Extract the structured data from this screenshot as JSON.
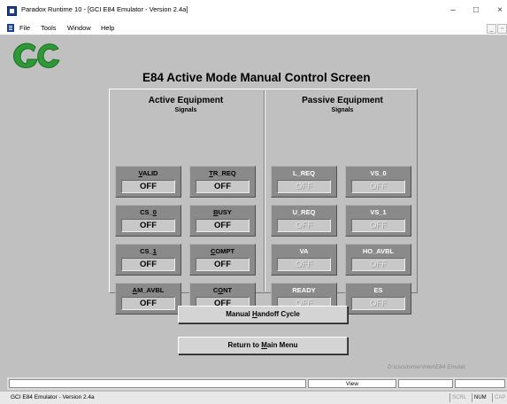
{
  "window": {
    "title": "Paradox Runtime 10 - [GCI E84 Emulator - Version 2.4a]",
    "minimize": "–",
    "maximize": "□",
    "close": "×"
  },
  "menu": {
    "items": [
      "File",
      "Tools",
      "Window",
      "Help"
    ],
    "mdi_minimize": "_",
    "mdi_restore": "▫"
  },
  "logo": {
    "text": "GC",
    "colors": [
      "#2e9a37",
      "#1b6e24"
    ]
  },
  "screen_title": "E84 Active Mode Manual Control Screen",
  "active": {
    "title": "Active Equipment",
    "subtitle": "Signals",
    "signals": [
      {
        "name": "VALID",
        "value": "OFF"
      },
      {
        "name": "TR_REQ",
        "value": "OFF"
      },
      {
        "name": "CS_0",
        "value": "OFF"
      },
      {
        "name": "BUSY",
        "value": "OFF"
      },
      {
        "name": "CS_1",
        "value": "OFF"
      },
      {
        "name": "COMPT",
        "value": "OFF"
      },
      {
        "name": "AM_AVBL",
        "value": "OFF"
      },
      {
        "name": "CONT",
        "value": "OFF"
      }
    ]
  },
  "passive": {
    "title": "Passive Equipment",
    "subtitle": "Signals",
    "signals": [
      {
        "name": "L_REQ",
        "value": "OFF"
      },
      {
        "name": "VS_0",
        "value": "OFF"
      },
      {
        "name": "U_REQ",
        "value": "OFF"
      },
      {
        "name": "VS_1",
        "value": "OFF"
      },
      {
        "name": "VA",
        "value": "OFF"
      },
      {
        "name": "HO_AVBL",
        "value": "OFF"
      },
      {
        "name": "READY",
        "value": "OFF"
      },
      {
        "name": "ES",
        "value": "OFF"
      }
    ]
  },
  "buttons": {
    "handoff": "Manual Handoff Cycle",
    "return": "Return to Main Menu"
  },
  "path": "D:\\cscutomer\\intel\\E84 Emulat",
  "mode_bar": {
    "view": "View"
  },
  "status": {
    "text": "GCI E84 Emulator - Version 2.4a",
    "indicators": [
      "SCRL",
      "NUM",
      "CAP"
    ]
  },
  "colors": {
    "panel_bg": "#c0c0c0",
    "signal_bg": "#8a8a8a",
    "logo_green": "#2e9a37"
  }
}
